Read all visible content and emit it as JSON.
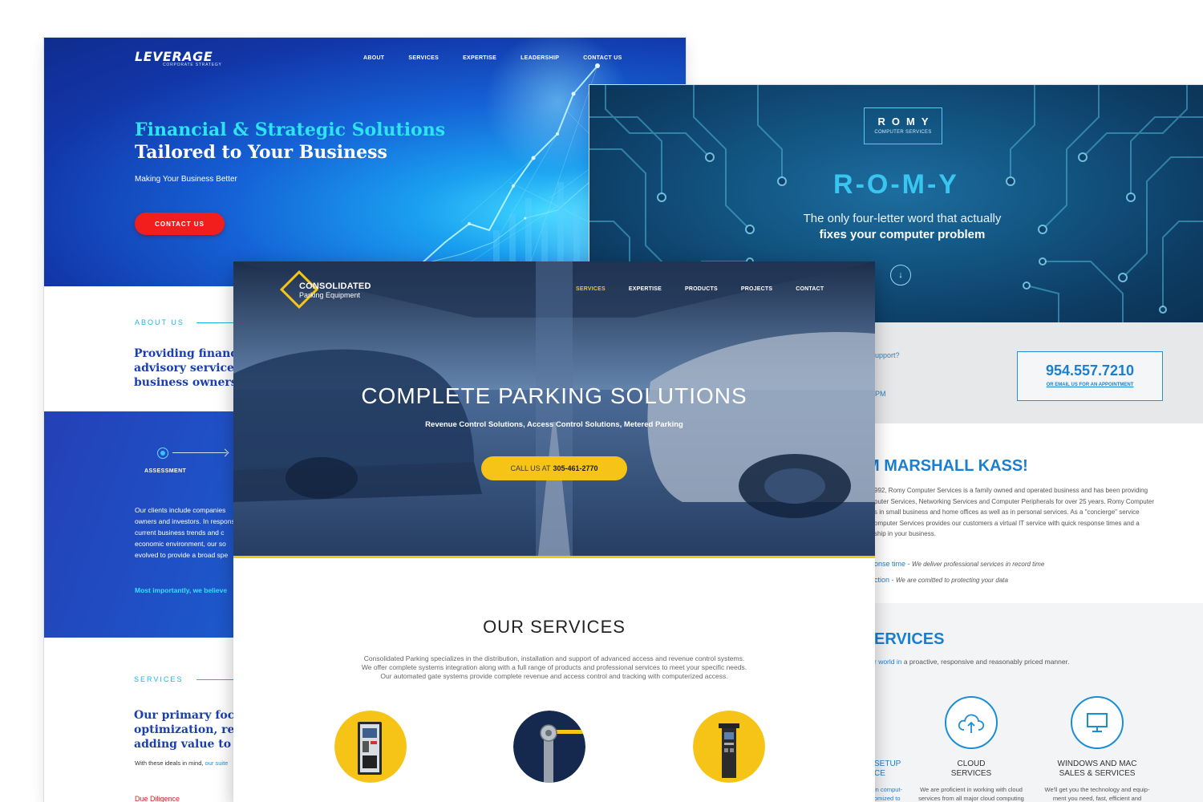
{
  "leverage": {
    "logo": "LEVERAGE",
    "logo_sub": "CORPORATE STRATEGY",
    "nav": [
      "ABOUT",
      "SERVICES",
      "EXPERTISE",
      "LEADERSHIP",
      "CONTACT US"
    ],
    "hero_title_1": "Financial & Strategic Solutions",
    "hero_title_2": "Tailored to Your Business",
    "hero_sub": "Making Your Business Better",
    "cta": "CONTACT US",
    "about_label": "ABOUT US",
    "about_heading": "Providing financial\nadvisory services\nbusiness owners",
    "assessment": "ASSESSMENT",
    "clients_text": "Our clients include companies\nowners and investors. In response\ncurrent business trends and c\neconomic environment, our so\nevolved to provide a broad spe",
    "importantly": "Most importantly, we believe",
    "services_label": "SERVICES",
    "services_heading": "Our primary focus\noptimization, re\nadding value to",
    "ideals_text": "With these ideals in mind,",
    "ideals_link": " our suite",
    "due_diligence": "Due Diligence"
  },
  "romy": {
    "logo_title": "ROMY",
    "logo_sub": "COMPUTER SERVICES",
    "big_title": "R-O-M-Y",
    "tagline_1": "The only four-letter word that actually",
    "tagline_2": "fixes your computer problem",
    "down_icon": "chevron-down-icon",
    "support_text": "upport?",
    "pm_text": "PM",
    "phone": "954.557.7210",
    "email_link": "OR EMAIL US FOR AN APPOINTMENT",
    "iam_heading": "M MARSHALL KASS!",
    "paragraph": "992, Romy Computer Services is a family owned and operated business and has been providing\nputer Services, Networking Services and Computer Peripherals for over 25 years. Romy Computer\ns in small business and home offices as well as in personal services. As a \"concierge\" service\nomputer Services provides our customers a virtual IT service with quick response times and a\nship in your business.",
    "resp_1_label": "onse time - ",
    "resp_1_desc": "We deliver professional services in record time",
    "resp_2_label": "ction - ",
    "resp_2_desc": "We are comitted to protecting your data",
    "services_heading": "ERVICES",
    "services_sub_link": "r world in",
    "services_sub": " a proactive, responsive and reasonably priced manner.",
    "setup_label": "SETUP\nCE",
    "setup_desc": "in comput-\nomized to",
    "cloud_label": "CLOUD\nSERVICES",
    "cloud_desc": "We are proficient in working with cloud\nservices from all major cloud computing",
    "win_label": "WINDOWS AND MAC\nSALES & SERVICES",
    "win_desc": "We'll get you the technology and equip-\nment you need, fast, efficient and"
  },
  "consolidated": {
    "logo_1": "CONSOLIDATED",
    "logo_2": "Parking Equipment",
    "nav": [
      "SERVICES",
      "EXPERTISE",
      "PRODUCTS",
      "PROJECTS",
      "CONTACT"
    ],
    "hero_title": "COMPLETE PARKING SOLUTIONS",
    "hero_sub": "Revenue Control Solutions,   Access Control Solutions,   Metered Parking",
    "cta_label": "CALL US AT",
    "cta_phone": "305-461-2770",
    "services_heading": "OUR SERVICES",
    "services_text": "Consolidated Parking specializes in the distribution, installation and support of advanced access and revenue control systems.\nWe offer complete systems integration along with a full range of products and professional services to meet your specific needs.\nOur automated gate systems provide complete revenue and access control and tracking with computerized access."
  },
  "colors": {
    "leverage_accent": "#2ee3f2",
    "leverage_cta": "#f21d1d",
    "romy_blue": "#1a7fd0",
    "consolidated_yellow": "#f6c416"
  }
}
